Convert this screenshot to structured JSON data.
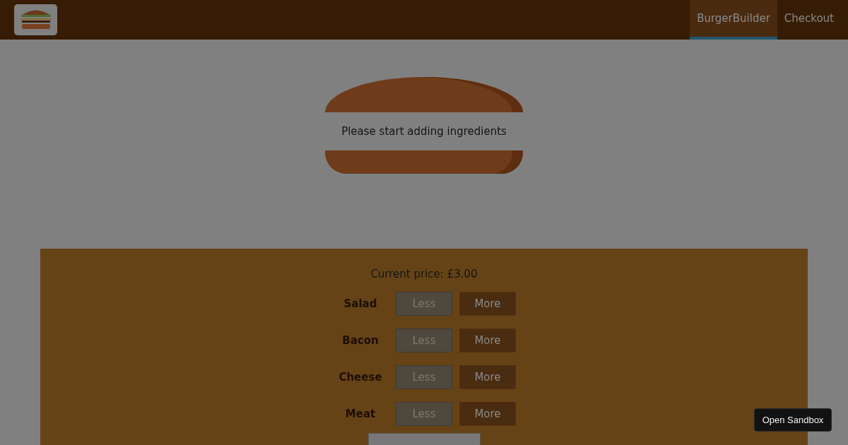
{
  "nav": [
    {
      "label": "BurgerBuilder",
      "selected": true
    },
    {
      "label": "Checkout",
      "selected": false
    }
  ],
  "burger": {
    "message": "Please start adding ingredients"
  },
  "controls": {
    "price": "Current price: £3.00",
    "ingredients": [
      {
        "label": "Salad",
        "less": "Less",
        "more": "More",
        "less_disabled": true
      },
      {
        "label": "Bacon",
        "less": "Less",
        "more": "More",
        "less_disabled": true
      },
      {
        "label": "Cheese",
        "less": "Less",
        "more": "More",
        "less_disabled": true
      },
      {
        "label": "Meat",
        "less": "Less",
        "more": "More",
        "less_disabled": true
      }
    ]
  },
  "sandbox_button": "Open Sandbox"
}
